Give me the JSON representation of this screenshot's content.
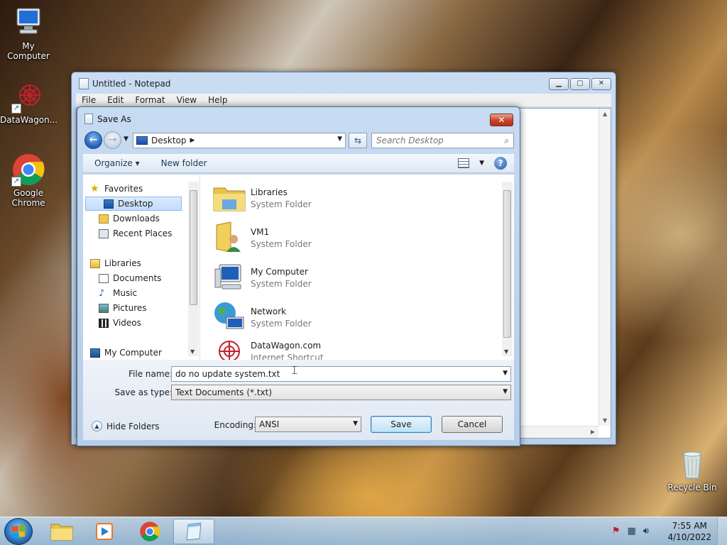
{
  "desktop": {
    "icons": [
      {
        "label": "My Computer",
        "icon": "computer-icon"
      },
      {
        "label": "DataWagon...",
        "icon": "datawagon-icon"
      },
      {
        "label": "Google Chrome",
        "icon": "chrome-icon"
      },
      {
        "label": "Recycle Bin",
        "icon": "recycle-bin-icon"
      }
    ]
  },
  "notepad": {
    "title": "Untitled - Notepad",
    "menu": [
      "File",
      "Edit",
      "Format",
      "View",
      "Help"
    ]
  },
  "dialog": {
    "title": "Save As",
    "address": "Desktop",
    "search_placeholder": "Search Desktop",
    "toolbar": {
      "organize": "Organize ▾",
      "new_folder": "New folder"
    },
    "nav": {
      "favorites": "Favorites",
      "desktop": "Desktop",
      "downloads": "Downloads",
      "recent": "Recent Places",
      "libraries": "Libraries",
      "documents": "Documents",
      "music": "Music",
      "pictures": "Pictures",
      "videos": "Videos",
      "my_computer": "My Computer"
    },
    "files": [
      {
        "name": "Libraries",
        "type": "System Folder"
      },
      {
        "name": "VM1",
        "type": "System Folder"
      },
      {
        "name": "My Computer",
        "type": "System Folder"
      },
      {
        "name": "Network",
        "type": "System Folder"
      },
      {
        "name": "DataWagon.com",
        "type": "Internet Shortcut"
      }
    ],
    "file_name_label": "File name:",
    "file_name_value": "do no update system.txt",
    "save_type_label": "Save as type:",
    "save_type_value": "Text Documents (*.txt)",
    "hide_folders": "Hide Folders",
    "encoding_label": "Encoding:",
    "encoding_value": "ANSI",
    "save_button": "Save",
    "cancel_button": "Cancel"
  },
  "taskbar": {
    "time": "7:55 AM",
    "date": "4/10/2022"
  }
}
